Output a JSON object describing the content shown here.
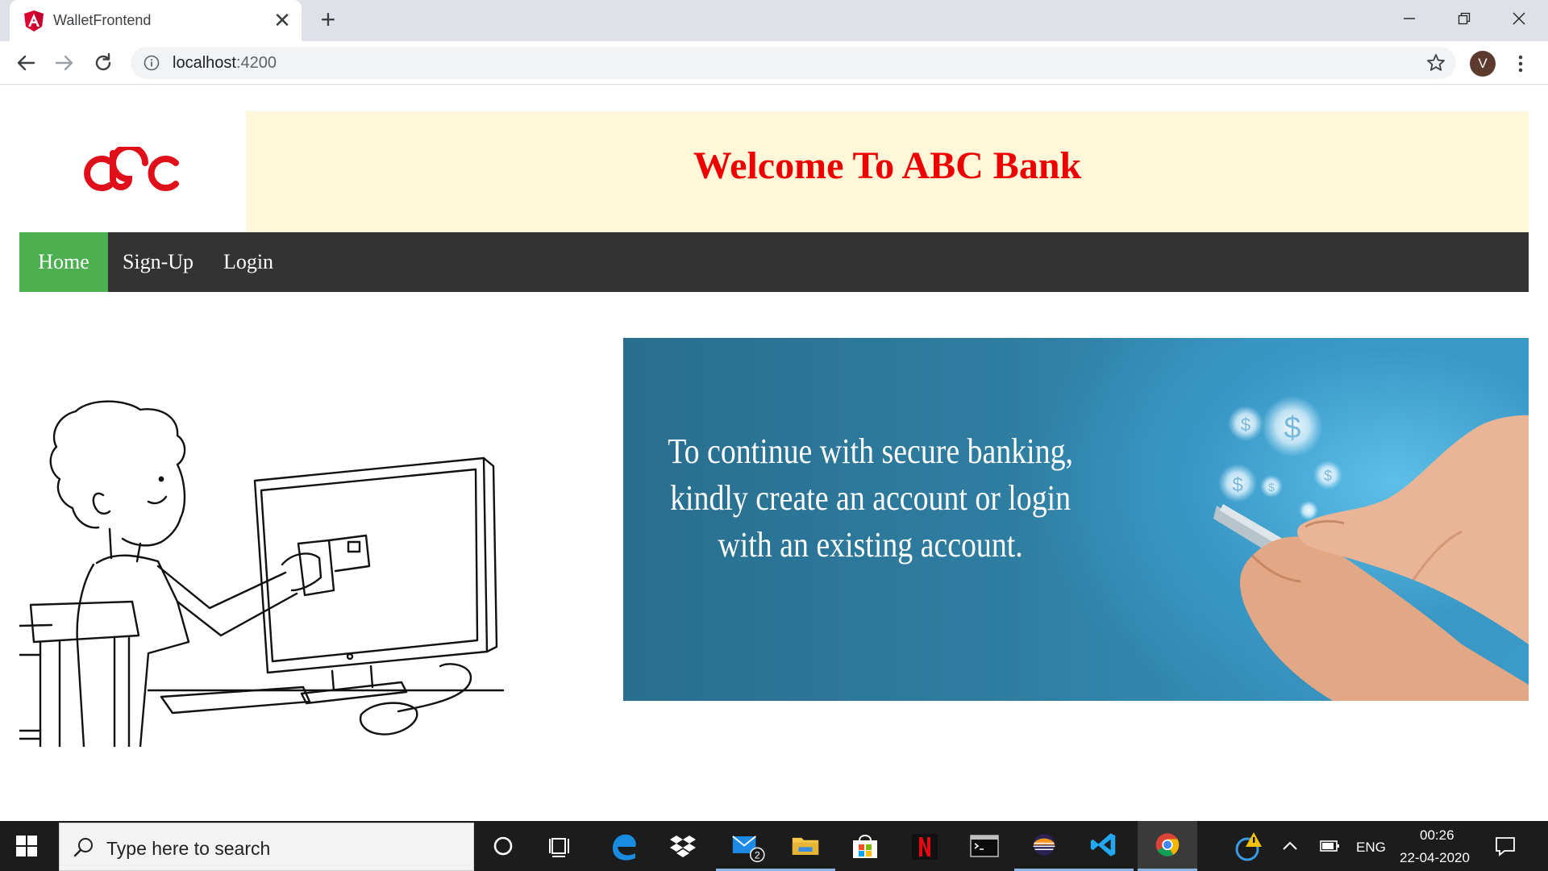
{
  "browser": {
    "tab": {
      "title": "WalletFrontend",
      "favicon": "angular-icon",
      "close_glyph": "✕"
    },
    "new_tab_glyph": "+",
    "window_controls": {
      "minimize": "—",
      "restore": "❐",
      "close": "✕"
    },
    "address": {
      "host": "localhost",
      "port": ":4200"
    },
    "profile_initial": "V"
  },
  "page": {
    "logo": "abc",
    "banner_title": "Welcome To ABC Bank",
    "nav": [
      {
        "label": "Home",
        "active": true
      },
      {
        "label": "Sign-Up",
        "active": false
      },
      {
        "label": "Login",
        "active": false
      }
    ],
    "hero_lines": [
      "To continue with secure banking,",
      "kindly create an account or login",
      "with an existing account."
    ],
    "colors": {
      "accent_red": "#ee0000",
      "nav_bg": "#333333",
      "nav_active": "#4caf50",
      "banner_bg": "#fff7d9"
    }
  },
  "taskbar": {
    "search_placeholder": "Type here to search",
    "apps": [
      "cortana-icon",
      "task-view-icon",
      "edge-icon",
      "dropbox-icon",
      "mail-icon",
      "file-explorer-icon",
      "store-icon",
      "netflix-icon",
      "terminal-icon",
      "eclipse-icon",
      "vscode-icon",
      "chrome-icon"
    ],
    "mail_badge": "2",
    "language": "ENG",
    "time": "00:26",
    "date": "22-04-2020"
  }
}
